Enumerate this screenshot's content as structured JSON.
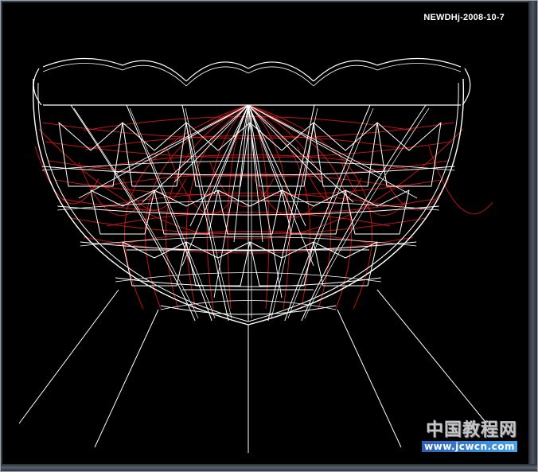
{
  "viewport": {
    "stamp": "NEWDHj-2008-10-7",
    "background_color": "#000000",
    "wire_primary_color": "#ffffff",
    "wire_secondary_color": "#d01818"
  },
  "watermark": {
    "site_name": "中国教程网",
    "site_url": "www.jcwcn.com"
  }
}
